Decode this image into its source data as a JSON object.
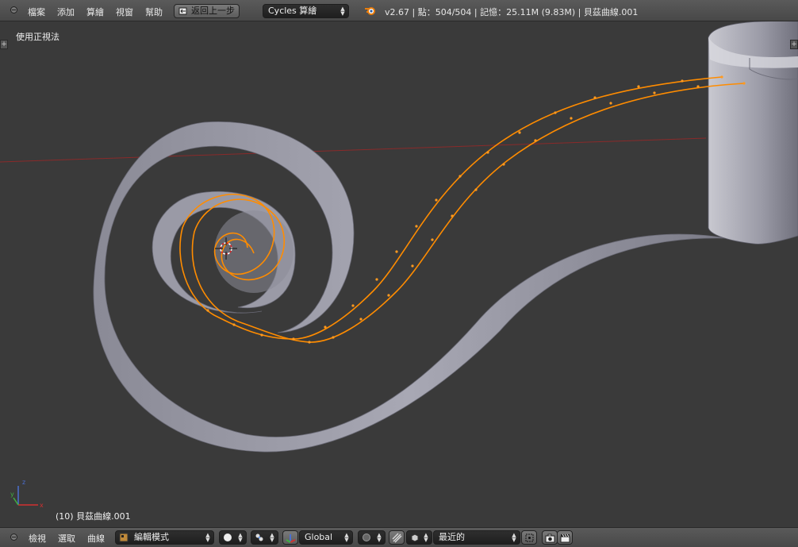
{
  "top": {
    "menus": [
      "檔案",
      "添加",
      "算繪",
      "視窗",
      "幫助"
    ],
    "undo_label": "返回上一步",
    "render_engine": "Cycles 算繪",
    "status": "v2.67 | 點：504/504 | 記憶：25.11M (9.83M) | 貝茲曲線.001"
  },
  "viewport": {
    "view_name": "使用正視法",
    "object_info": "(10) 貝茲曲線.001",
    "axis_x": "x",
    "axis_y": "y",
    "axis_z": "z"
  },
  "bottom": {
    "menus": [
      "檢視",
      "選取",
      "曲線"
    ],
    "mode": "編輯模式",
    "orientation": "Global",
    "snap_target": "最近的"
  },
  "colors": {
    "viewport_bg": "#3a3a3a",
    "curve": "#ff8c00",
    "mesh": "#9a9aa6",
    "horizon_line": "#8a2a2a"
  }
}
